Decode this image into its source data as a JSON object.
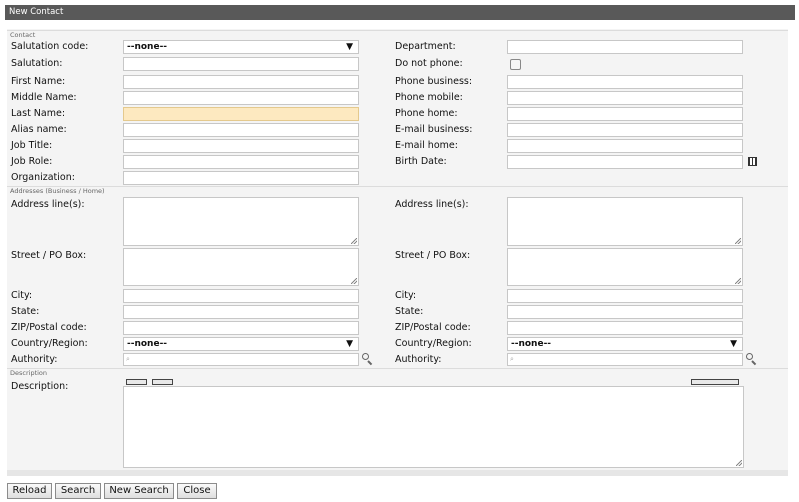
{
  "window": {
    "title": "New Contact"
  },
  "sections": {
    "contact": "Contact",
    "addresses": "Addresses (Business / Home)",
    "description": "Description"
  },
  "contact": {
    "salutation_code": {
      "label": "Salutation code:",
      "value": "--none--"
    },
    "salutation": {
      "label": "Salutation:",
      "value": ""
    },
    "first_name": {
      "label": "First Name:",
      "value": ""
    },
    "middle_name": {
      "label": "Middle Name:",
      "value": ""
    },
    "last_name": {
      "label": "Last Name:",
      "value": ""
    },
    "alias_name": {
      "label": "Alias name:",
      "value": ""
    },
    "job_title": {
      "label": "Job Title:",
      "value": ""
    },
    "job_role": {
      "label": "Job Role:",
      "value": ""
    },
    "organization": {
      "label": "Organization:",
      "value": ""
    },
    "department": {
      "label": "Department:",
      "value": ""
    },
    "do_not_phone": {
      "label": "Do not phone:",
      "checked": false
    },
    "phone_business": {
      "label": "Phone business:",
      "value": ""
    },
    "phone_mobile": {
      "label": "Phone mobile:",
      "value": ""
    },
    "phone_home": {
      "label": "Phone home:",
      "value": ""
    },
    "email_business": {
      "label": "E-mail business:",
      "value": ""
    },
    "email_home": {
      "label": "E-mail home:",
      "value": ""
    },
    "birth_date": {
      "label": "Birth Date:",
      "value": ""
    }
  },
  "address_business": {
    "address_lines": {
      "label": "Address line(s):",
      "value": ""
    },
    "street": {
      "label": "Street / PO Box:",
      "value": ""
    },
    "city": {
      "label": "City:",
      "value": ""
    },
    "state": {
      "label": "State:",
      "value": ""
    },
    "zip": {
      "label": "ZIP/Postal code:",
      "value": ""
    },
    "country": {
      "label": "Country/Region:",
      "value": "--none--"
    },
    "authority": {
      "label": "Authority:",
      "value": ""
    }
  },
  "address_home": {
    "address_lines": {
      "label": "Address line(s):",
      "value": ""
    },
    "street": {
      "label": "Street / PO Box:",
      "value": ""
    },
    "city": {
      "label": "City:",
      "value": ""
    },
    "state": {
      "label": "State:",
      "value": ""
    },
    "zip": {
      "label": "ZIP/Postal code:",
      "value": ""
    },
    "country": {
      "label": "Country/Region:",
      "value": "--none--"
    },
    "authority": {
      "label": "Authority:",
      "value": ""
    }
  },
  "description": {
    "label": "Description:",
    "value": ""
  },
  "buttons": {
    "reload": "Reload",
    "search": "Search",
    "new_search": "New Search",
    "close": "Close"
  },
  "icons": {
    "lookup": "search-icon",
    "calendar": "calendar-icon",
    "dropdown": "▼"
  },
  "colors": {
    "titlebar": "#595959",
    "panel": "#f4f4f4",
    "required_field": "#fde9c0"
  }
}
